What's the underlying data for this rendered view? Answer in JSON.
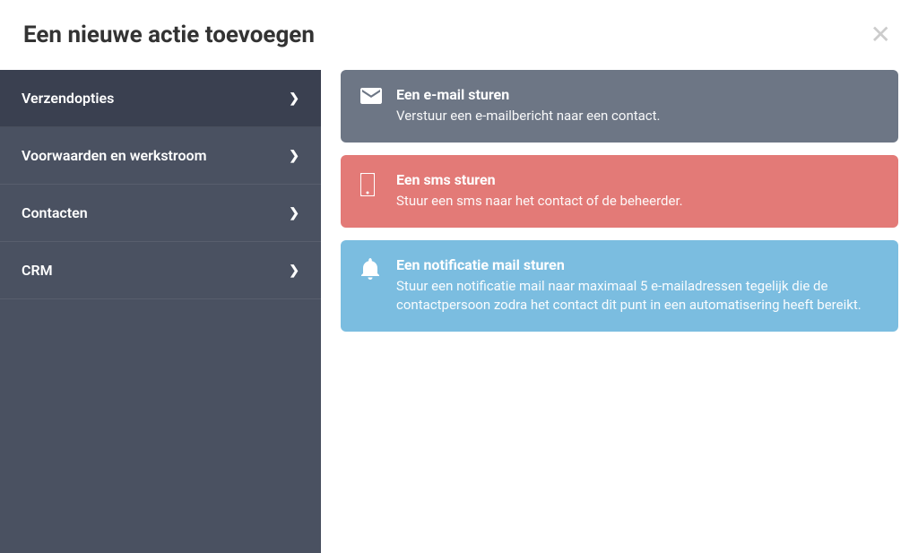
{
  "header": {
    "title": "Een nieuwe actie toevoegen"
  },
  "sidebar": {
    "items": [
      {
        "label": "Verzendopties",
        "active": true
      },
      {
        "label": "Voorwaarden en werkstroom",
        "active": false
      },
      {
        "label": "Contacten",
        "active": false
      },
      {
        "label": "CRM",
        "active": false
      }
    ]
  },
  "actions": {
    "email": {
      "title": "Een e-mail sturen",
      "desc": "Verstuur een e-mailbericht naar een contact."
    },
    "sms": {
      "title": "Een sms sturen",
      "desc": "Stuur een sms naar het contact of de beheerder."
    },
    "notify": {
      "title": "Een notificatie mail sturen",
      "desc": "Stuur een notificatie mail naar maximaal 5 e-mailadressen tegelijk die de contactpersoon zodra het contact dit punt in een automatisering heeft bereikt."
    }
  }
}
